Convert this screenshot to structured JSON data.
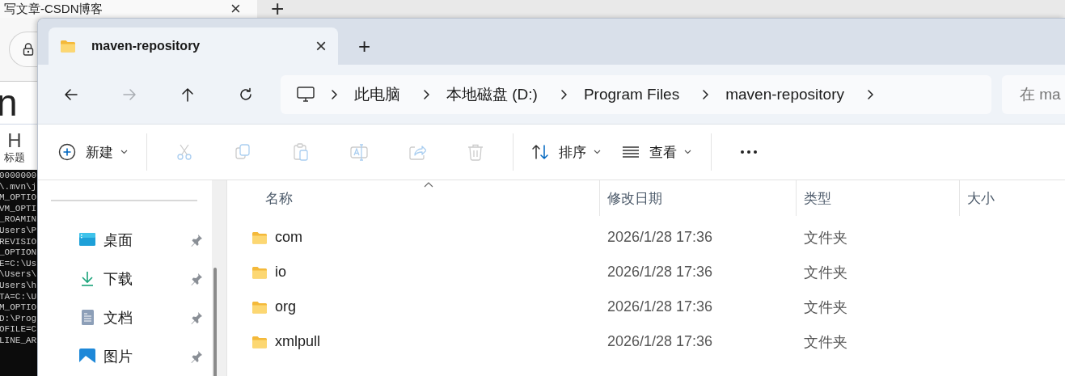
{
  "background_browser": {
    "tab_title": "写文章-CSDN博客",
    "tab_close": "×",
    "new_tab": "+",
    "editor_glyph": "n",
    "heading_tool": {
      "glyph": "H",
      "label": "标题"
    },
    "terminal_lines": [
      "0000000",
      "\\.mvn\\j",
      "M_OPTIO",
      "VM_OPTI",
      "_ROAMIN",
      "Users\\P",
      "REVISIO",
      "_OPTION",
      "E=C:\\Us",
      "\\Users\\",
      "Users\\h",
      "TA=C:\\U",
      "M_OPTIO",
      "D:\\Prog",
      "OFILE=C",
      "LINE_AR"
    ]
  },
  "window": {
    "tab": {
      "title": "maven-repository",
      "close": "×",
      "selected": true
    },
    "new_tab": "+",
    "nav": [
      {
        "kind": "back",
        "disabled": false
      },
      {
        "kind": "forward",
        "disabled": true
      },
      {
        "kind": "up",
        "disabled": false
      },
      {
        "kind": "refresh",
        "disabled": false
      }
    ],
    "breadcrumb": [
      "此电脑",
      "本地磁盘 (D:)",
      "Program Files",
      "maven-repository"
    ],
    "search": {
      "placeholder": "在 ma"
    },
    "toolbar": {
      "groups": [
        {
          "items": [
            {
              "kind": "new",
              "label": "新建",
              "dropdown": true,
              "disabled": false
            }
          ]
        },
        {
          "items": [
            {
              "kind": "cut",
              "disabled": true
            },
            {
              "kind": "copy",
              "disabled": true
            },
            {
              "kind": "paste",
              "disabled": true
            },
            {
              "kind": "rename",
              "disabled": true
            },
            {
              "kind": "share",
              "disabled": true
            },
            {
              "kind": "delete",
              "disabled": true
            }
          ]
        },
        {
          "items": [
            {
              "kind": "sort",
              "label": "排序",
              "dropdown": true,
              "disabled": false
            },
            {
              "kind": "view",
              "label": "查看",
              "dropdown": true,
              "disabled": false
            }
          ]
        },
        {
          "items": [
            {
              "kind": "more"
            }
          ]
        }
      ]
    },
    "sidebar": {
      "items": [
        {
          "kind": "desktop",
          "label": "桌面",
          "pinned": true
        },
        {
          "kind": "downloads",
          "label": "下载",
          "pinned": true
        },
        {
          "kind": "documents",
          "label": "文档",
          "pinned": true
        },
        {
          "kind": "pictures",
          "label": "图片",
          "pinned": true
        }
      ]
    },
    "table": {
      "columns": [
        {
          "label": "名称",
          "sorted": true
        },
        {
          "label": "修改日期",
          "sorted": false
        },
        {
          "label": "类型",
          "sorted": false
        },
        {
          "label": "大小",
          "sorted": false
        }
      ],
      "rows": [
        {
          "name": "com",
          "modified": "2026/1/28 17:36",
          "type": "文件夹"
        },
        {
          "name": "io",
          "modified": "2026/1/28 17:36",
          "type": "文件夹"
        },
        {
          "name": "org",
          "modified": "2026/1/28 17:36",
          "type": "文件夹"
        },
        {
          "name": "xmlpull",
          "modified": "2026/1/28 17:36",
          "type": "文件夹"
        }
      ]
    }
  }
}
